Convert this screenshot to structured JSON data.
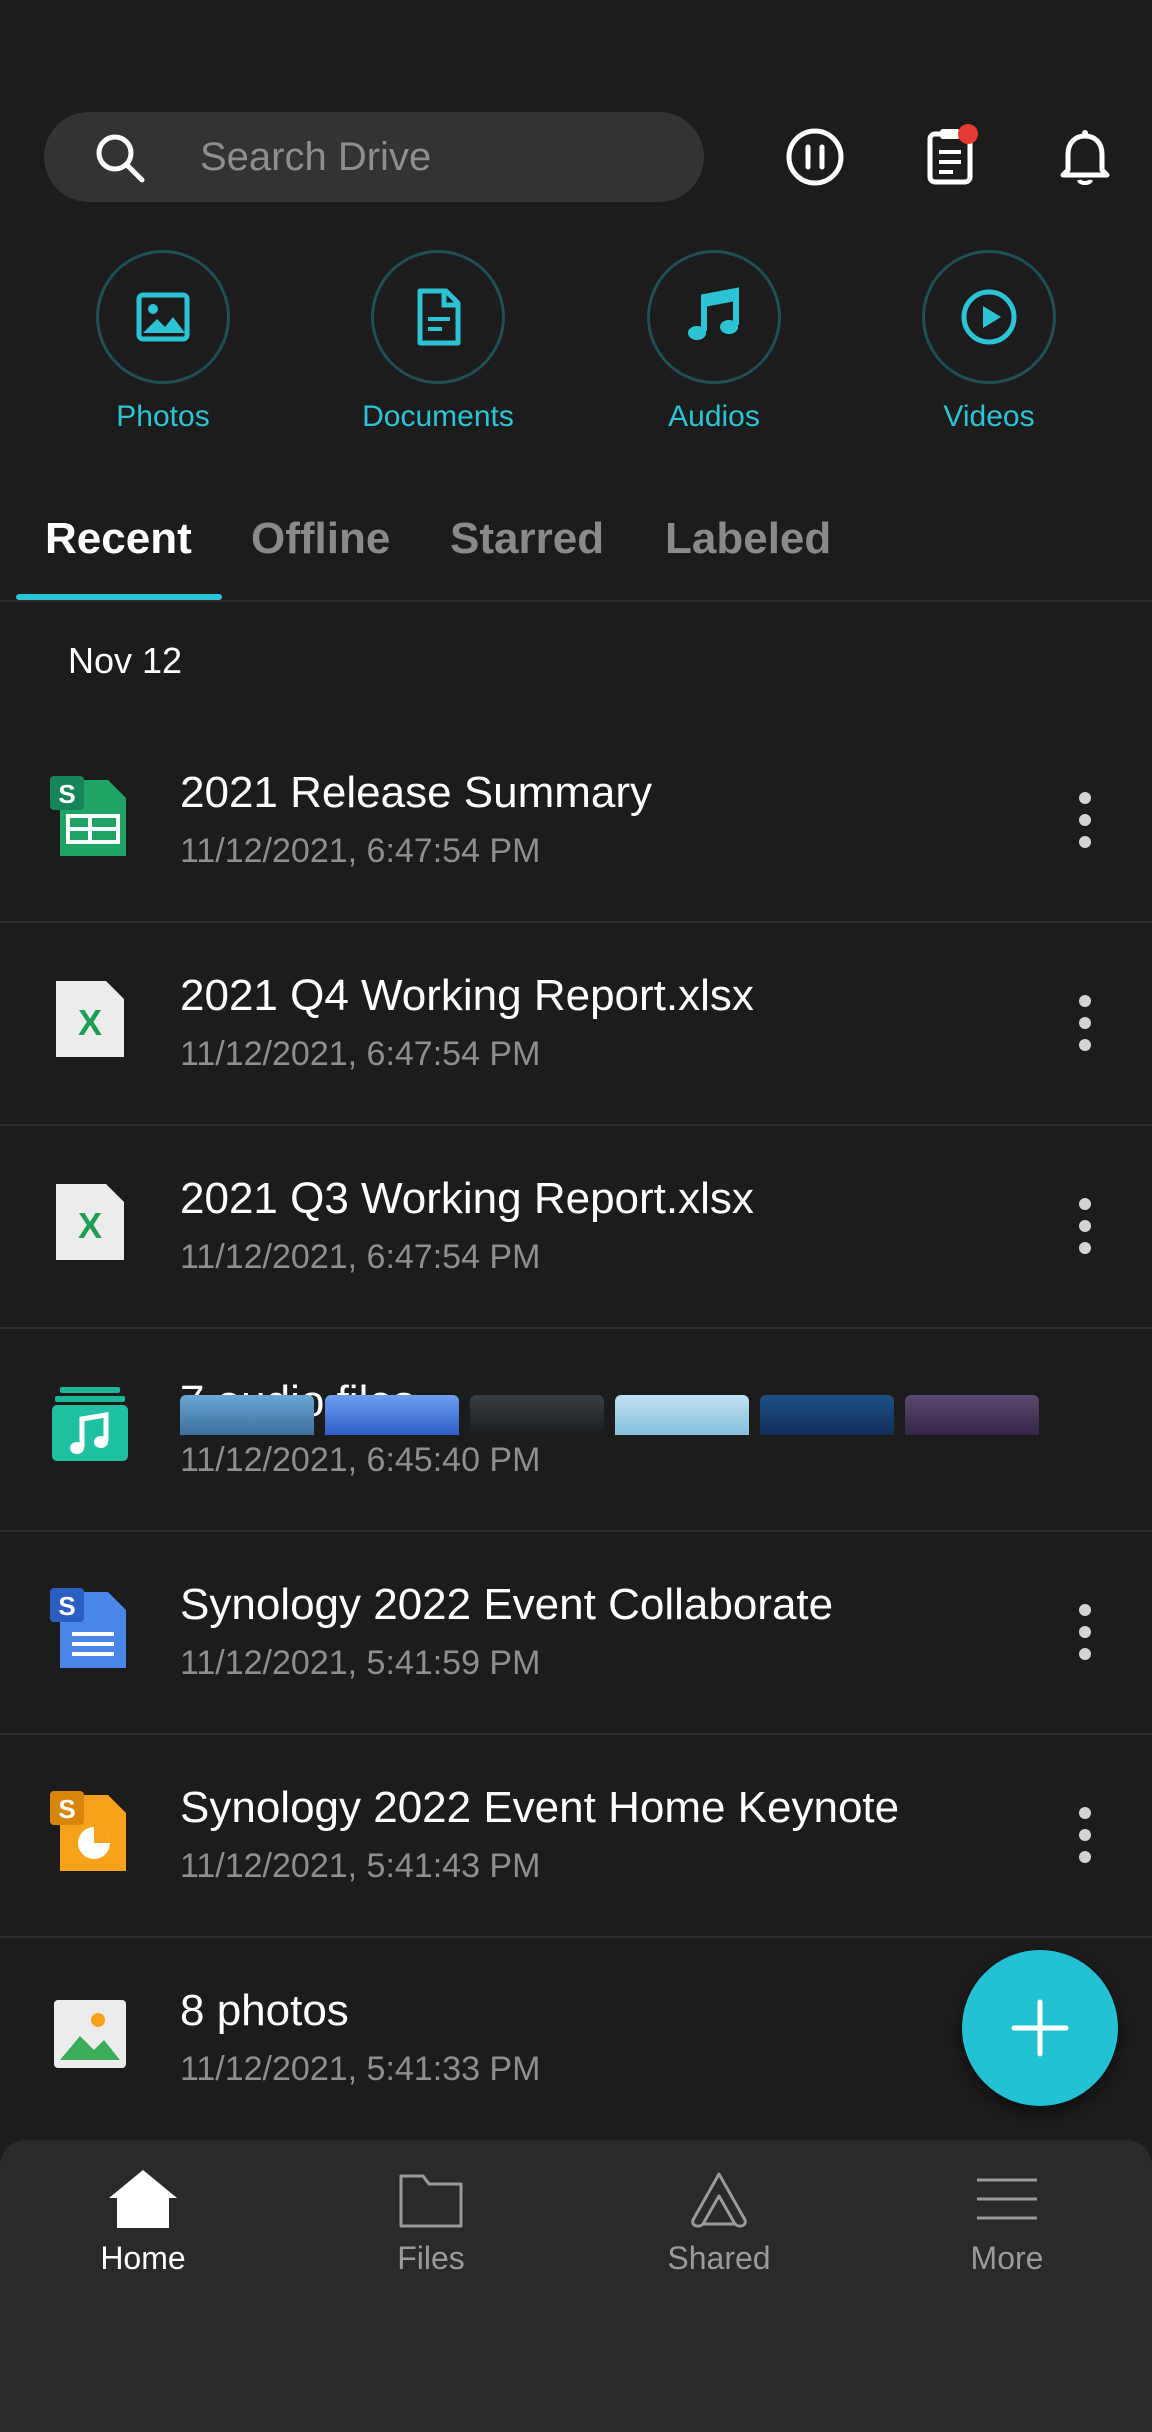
{
  "search": {
    "placeholder": "Search Drive"
  },
  "categories": [
    {
      "label": "Photos",
      "icon": "image-icon"
    },
    {
      "label": "Documents",
      "icon": "document-icon"
    },
    {
      "label": "Audios",
      "icon": "music-note-icon"
    },
    {
      "label": "Videos",
      "icon": "play-icon"
    }
  ],
  "tabs": [
    {
      "label": "Recent",
      "active": true
    },
    {
      "label": "Offline",
      "active": false
    },
    {
      "label": "Starred",
      "active": false
    },
    {
      "label": "Labeled",
      "active": false
    }
  ],
  "section_date": "Nov 12",
  "files": [
    {
      "title": "2021 Release Summary",
      "meta": "11/12/2021, 6:47:54 PM",
      "icon": "synology-spreadsheet-icon"
    },
    {
      "title": "2021 Q4 Working Report.xlsx",
      "meta": "11/12/2021, 6:47:54 PM",
      "icon": "excel-icon"
    },
    {
      "title": "2021 Q3 Working Report.xlsx",
      "meta": "11/12/2021, 6:47:54 PM",
      "icon": "excel-icon"
    },
    {
      "title": "7 audio files",
      "meta": "11/12/2021, 6:45:40 PM",
      "icon": "audio-stack-icon"
    },
    {
      "title": "Synology 2022 Event Collaborate",
      "meta": "11/12/2021, 5:41:59 PM",
      "icon": "synology-document-icon"
    },
    {
      "title": "Synology 2022 Event Home Keynote",
      "meta": "11/12/2021, 5:41:43 PM",
      "icon": "synology-slides-icon"
    },
    {
      "title": "8 photos",
      "meta": "11/12/2021, 5:41:33 PM",
      "icon": "photo-icon"
    }
  ],
  "nav": [
    {
      "label": "Home",
      "active": true
    },
    {
      "label": "Files",
      "active": false
    },
    {
      "label": "Shared",
      "active": false
    },
    {
      "label": "More",
      "active": false
    }
  ],
  "colors": {
    "accent": "#22c1d3",
    "background": "#1c1c1d",
    "notification_badge": "#e53935"
  }
}
